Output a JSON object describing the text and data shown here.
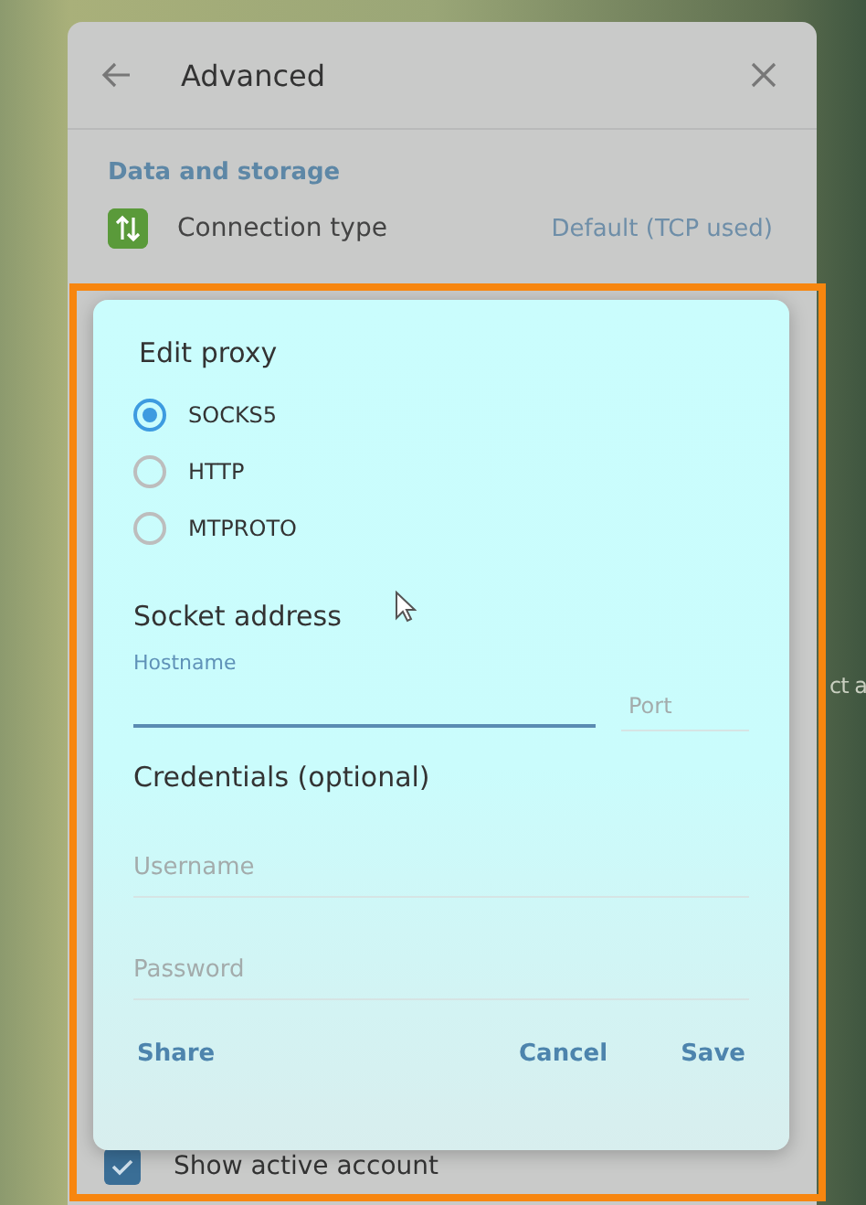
{
  "window": {
    "title": "Advanced"
  },
  "section": {
    "title": "Data and storage"
  },
  "settings": [
    {
      "label": "Connection type",
      "value": "Default (TCP used)"
    }
  ],
  "checkbox_row": {
    "label": "Show active account",
    "checked": true
  },
  "background_text": "ct a",
  "dialog": {
    "title": "Edit proxy",
    "proxy_types": [
      {
        "label": "SOCKS5",
        "selected": true
      },
      {
        "label": "HTTP",
        "selected": false
      },
      {
        "label": "MTPROTO",
        "selected": false
      }
    ],
    "socket_title": "Socket address",
    "hostname": {
      "label": "Hostname",
      "focused": true
    },
    "port": {
      "placeholder": "Port"
    },
    "credentials_title": "Credentials (optional)",
    "username": {
      "placeholder": "Username"
    },
    "password": {
      "placeholder": "Password"
    },
    "buttons": [
      {
        "label": "Share",
        "kind": "aside"
      },
      {
        "label": "Cancel",
        "kind": "action"
      },
      {
        "label": "Save",
        "kind": "action"
      }
    ]
  }
}
